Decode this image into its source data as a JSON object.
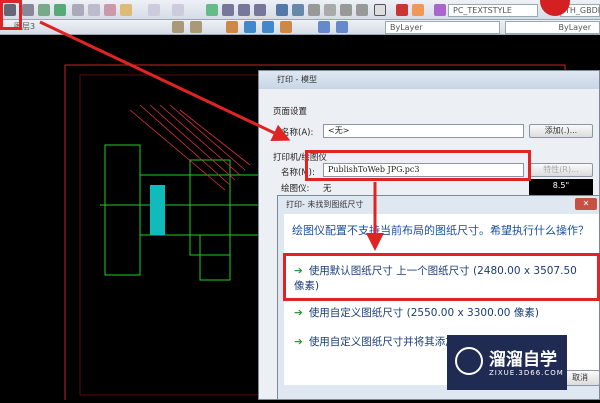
{
  "toolbar": {
    "text_style": "PC_TEXTSTYLE",
    "dim_style": "TH_GBDI",
    "layer": "图层3",
    "color": "ByLayer",
    "linetype": "ByLayer"
  },
  "print_dialog": {
    "title": "打印 - 模型",
    "page_setup_label": "页面设置",
    "name_label": "名称(A):",
    "name_value": "<无>",
    "add_button": "添加(.)...",
    "printer_label": "打印机/绘图仪",
    "printer_name_label": "名称(M):",
    "printer_value": "PublishToWeb JPG.pc3",
    "properties_button": "特性(R)...",
    "plotter_label": "绘图仪:",
    "plotter_value": "无",
    "preview_dim": "8.5\""
  },
  "paper_dialog": {
    "title": "打印- 未找到图纸尺寸",
    "question": "绘图仪配置不支持当前布局的图纸尺寸。希望执行什么操作？",
    "options": [
      "使用默认图纸尺寸 上一个图纸尺寸 (2480.00 x 3507.50 像素)",
      "使用自定义图纸尺寸 (2550.00 x 3300.00 像素)",
      "使用自定义图纸尺寸并将其添加到绘图仪配置"
    ],
    "cancel_button": "取消"
  },
  "watermark": {
    "name": "溜溜自学",
    "url": "ZIXUE.3D66.COM"
  },
  "colors": {
    "highlight": "#e02424",
    "link": "#1b3c78"
  }
}
